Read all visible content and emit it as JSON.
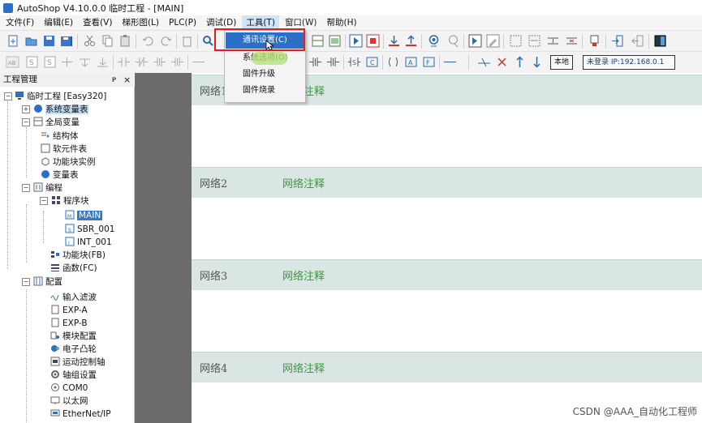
{
  "window": {
    "title": "AutoShop V4.10.0.0  临时工程 - [MAIN]"
  },
  "menu": [
    "文件(F)",
    "编辑(E)",
    "查看(V)",
    "梯形图(L)",
    "PLC(P)",
    "调试(D)",
    "工具(T)",
    "窗口(W)",
    "帮助(H)"
  ],
  "toolbar": {
    "local_label": "本地",
    "connection_label": "未登录 IP:192.168.0.1"
  },
  "tools_menu": {
    "items": [
      "通讯设置(C)",
      "系统选项(O)",
      "固件升级",
      "固件烧录"
    ]
  },
  "project_panel": {
    "title": "工程管理",
    "pin": "ᴘ",
    "close": "×",
    "tree": {
      "root": "临时工程 [Easy320]",
      "system_vars": "系统变量表",
      "global_vars": "全局变量",
      "struct": "结构体",
      "soft_elements": "软元件表",
      "fb_instance": "功能块实例",
      "var_table": "变量表",
      "programming": "编程",
      "program_block": "程序块",
      "main": "MAIN",
      "sbr": "SBR_001",
      "int": "INT_001",
      "fb": "功能块(FB)",
      "fc": "函数(FC)",
      "config": "配置",
      "input_filter": "输入滤波",
      "exp_a": "EXP-A",
      "exp_b": "EXP-B",
      "module_config": "模块配置",
      "cam": "电子凸轮",
      "motion_axis": "运动控制轴",
      "axis_group": "轴组设置",
      "com0": "COM0",
      "ethernet": "以太网",
      "ethernet_ip": "EtherNet/IP"
    }
  },
  "networks": [
    {
      "title": "网络1",
      "comment": "网络注释"
    },
    {
      "title": "网络2",
      "comment": "网络注释"
    },
    {
      "title": "网络3",
      "comment": "网络注释"
    },
    {
      "title": "网络4",
      "comment": "网络注释"
    }
  ],
  "watermark": "CSDN @AAA_自动化工程师",
  "colors": {
    "accent": "#2b6fc7",
    "highlight_box": "#e02020",
    "comment_green": "#3a9a3a",
    "network_header": "#d9e6e3"
  }
}
